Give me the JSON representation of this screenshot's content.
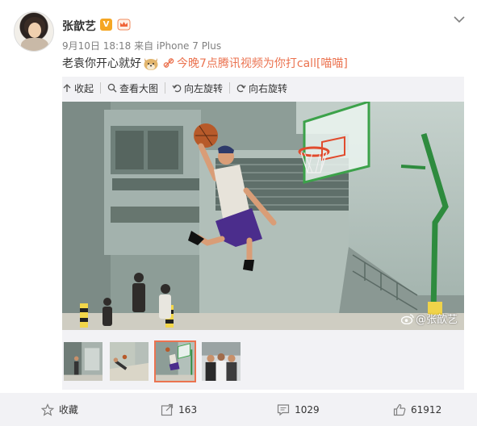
{
  "post": {
    "username": "张歆艺",
    "verified_badge": "V",
    "meta": "9月10日 18:18 来自 iPhone 7 Plus",
    "text": "老袁你开心就好",
    "link_text": "今晚7点腾讯视频为你打call[喵喵]"
  },
  "toolbar": {
    "collapse_label": "收起",
    "view_large_label": "查看大图",
    "rotate_left_label": "向左旋转",
    "rotate_right_label": "向右旋转"
  },
  "photo": {
    "watermark": "@张歆艺"
  },
  "thumbnails": {
    "count": 4,
    "active_index": 2
  },
  "footer": {
    "favorite_label": "收藏",
    "repost_count": "163",
    "comment_count": "1029",
    "like_count": "61912"
  },
  "colors": {
    "accent": "#eb7350",
    "panel_bg": "#f2f2f5",
    "badge": "#f5a623"
  },
  "icons": [
    "chevron-down-icon",
    "collapse-arrow-icon",
    "magnifier-icon",
    "rotate-left-icon",
    "rotate-right-icon",
    "link-icon",
    "weibo-logo-icon",
    "star-icon",
    "repost-icon",
    "comment-icon",
    "like-icon"
  ]
}
